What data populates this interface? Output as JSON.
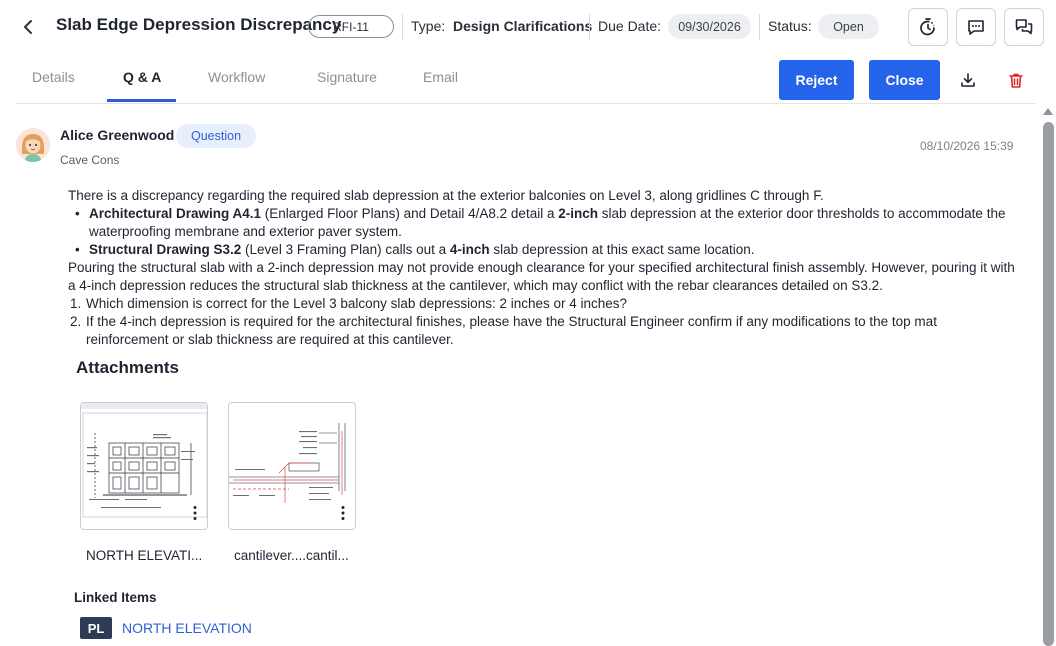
{
  "header": {
    "title": "Slab Edge Depression Discrepancy",
    "rfi_id": "RFI-11",
    "type_label": "Type:",
    "type_value": "Design Clarifications",
    "due_label": "Due Date:",
    "due_value": "09/30/2026",
    "status_label": "Status:",
    "status_value": "Open",
    "icons": [
      "back-chevron-icon",
      "timer-icon",
      "comment-icon",
      "conversation-icon"
    ]
  },
  "tabs": [
    {
      "label": "Details",
      "active": false
    },
    {
      "label": "Q & A",
      "active": true
    },
    {
      "label": "Workflow",
      "active": false
    },
    {
      "label": "Signature",
      "active": false
    },
    {
      "label": "Email",
      "active": false
    }
  ],
  "actions": {
    "reject_label": "Reject",
    "close_label": "Close",
    "icons": [
      "download-icon",
      "trash-icon"
    ],
    "primary_color": "#2563eb",
    "danger_color": "#e02424"
  },
  "post": {
    "author": "Alice Greenwood",
    "role_badge": "Question",
    "company": "Cave Cons",
    "timestamp": "08/10/2026 15:39",
    "intro": "There is a discrepancy regarding the required slab depression at the exterior balconies on Level 3, along gridlines C through F.",
    "bullets": [
      {
        "bold": "Architectural Drawing A4.1",
        "text_a": " (Enlarged Floor Plans) and Detail 4/A8.2 detail a ",
        "bold2": "2-inch",
        "text_b": " slab depression at the exterior door thresholds to accommodate the waterproofing membrane and exterior paver system."
      },
      {
        "bold": "Structural Drawing S3.2",
        "text_a": " (Level 3 Framing Plan) calls out a ",
        "bold2": "4-inch",
        "text_b": " slab depression at this exact same location."
      }
    ],
    "paragraph": "Pouring the structural slab with a 2-inch depression may not provide enough clearance for your specified architectural finish assembly. However, pouring it with a 4-inch depression reduces the structural slab thickness at the cantilever, which may conflict with the rebar clearances detailed on S3.2.",
    "questions": [
      {
        "num": "1.",
        "text": "Which dimension is correct for the Level 3 balcony slab depressions: 2 inches or 4 inches?"
      },
      {
        "num": "2.",
        "text": "If the 4-inch depression is required for the architectural finishes, please have the Structural Engineer confirm if any modifications to the top mat reinforcement or slab thickness are required at this cantilever."
      }
    ]
  },
  "attachments": {
    "title": "Attachments",
    "items": [
      {
        "name": "NORTH ELEVATI...",
        "icon": "kebab-menu-icon"
      },
      {
        "name": "cantilever....cantil...",
        "icon": "kebab-menu-icon"
      }
    ]
  },
  "linked": {
    "title": "Linked Items",
    "items": [
      {
        "badge": "PL",
        "label": "NORTH ELEVATION"
      }
    ]
  }
}
